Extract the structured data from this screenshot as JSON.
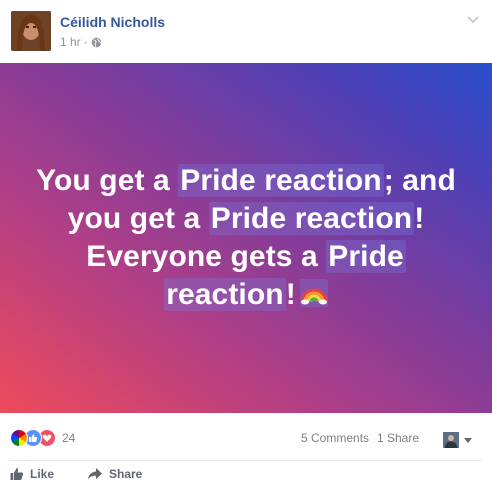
{
  "post": {
    "author": "Céilidh Nicholls",
    "time": "1 hr",
    "separator": "·",
    "body_lines": [
      {
        "parts": [
          {
            "t": "You get a ",
            "h": false
          },
          {
            "t": "Pride reaction",
            "h": true
          },
          {
            "t": "; and",
            "h": false
          }
        ]
      },
      {
        "parts": [
          {
            "t": "you get a ",
            "h": false
          },
          {
            "t": "Pride reaction",
            "h": true
          },
          {
            "t": "!",
            "h": false
          }
        ]
      },
      {
        "parts": [
          {
            "t": "Everyone gets a ",
            "h": false
          },
          {
            "t": "Pride",
            "h": true
          }
        ]
      },
      {
        "parts": [
          {
            "t": "reaction",
            "h": true
          },
          {
            "t": "!",
            "h": false
          }
        ]
      }
    ],
    "body_emoji": "rainbow-icon"
  },
  "stats": {
    "reaction_count": "24",
    "comments": "5 Comments",
    "shares": "1 Share"
  },
  "actions": {
    "like_label": "Like",
    "share_label": "Share"
  },
  "colors": {
    "author_link": "#365899",
    "meta_gray": "#90949c",
    "action_gray": "#606770",
    "like_blue": "#5890ff",
    "love_red": "#f25268"
  }
}
